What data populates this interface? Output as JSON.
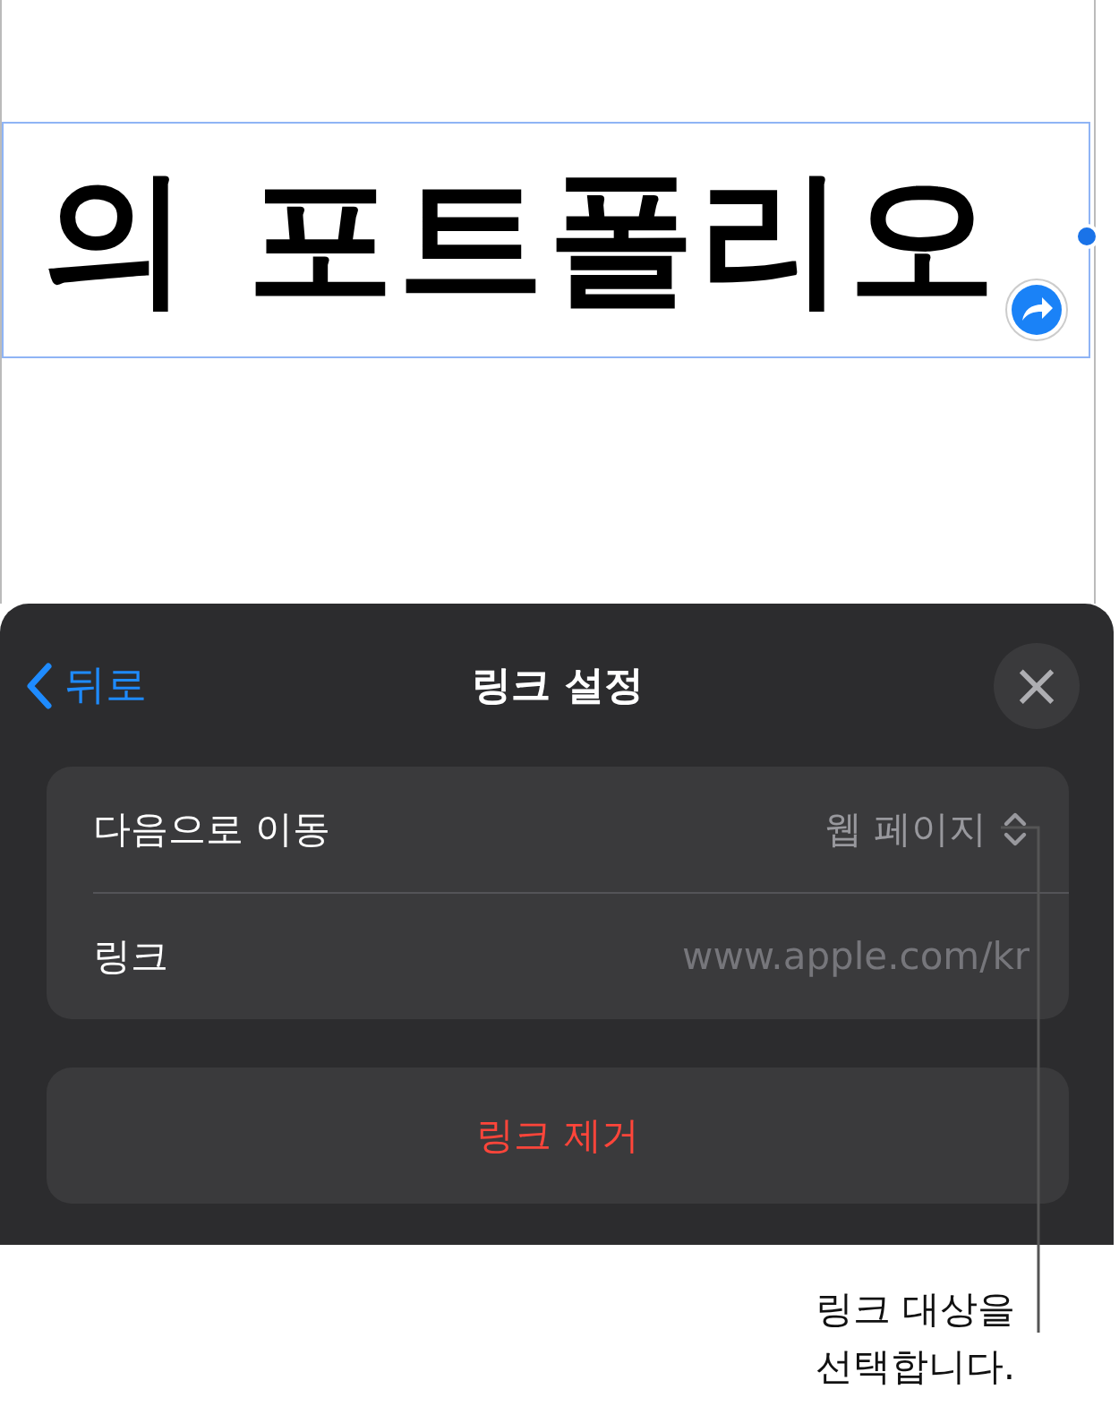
{
  "document": {
    "title_text": "의 포트폴리오"
  },
  "panel": {
    "back": {
      "label": "뒤로"
    },
    "title": "링크 설정",
    "close": "×",
    "rows": [
      {
        "kind": "picker",
        "label": "다음으로 이동",
        "value": "웹 페이지"
      },
      {
        "kind": "field",
        "label": "링크",
        "placeholder": "www.apple.com/kr"
      }
    ],
    "remove_button": "링크 제거"
  },
  "callout": {
    "text": "링크 대상을\n선택합니다."
  }
}
